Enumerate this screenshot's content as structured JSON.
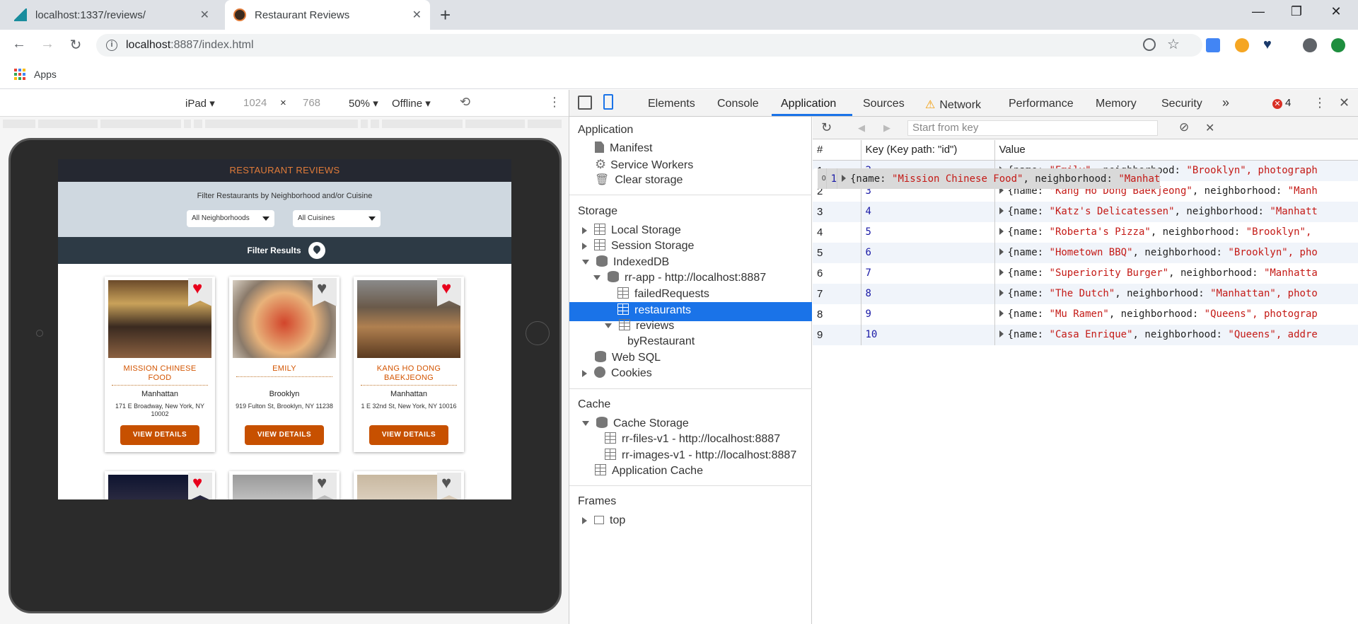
{
  "browser": {
    "tabs": [
      {
        "title": "localhost:1337/reviews/"
      },
      {
        "title": "Restaurant Reviews"
      }
    ],
    "url_host": "localhost",
    "url_rest": ":8887/index.html",
    "bookmarks_apps": "Apps"
  },
  "device_toolbar": {
    "device": "iPad",
    "width": "1024",
    "times": "×",
    "height": "768",
    "zoom": "50%",
    "throttle": "Offline"
  },
  "site": {
    "title": "RESTAURANT REVIEWS",
    "filter_title": "Filter Restaurants by Neighborhood and/or Cuisine",
    "neighborhood_select": "All Neighborhoods",
    "cuisine_select": "All Cuisines",
    "filter_results": "Filter Results",
    "view_details": "VIEW DETAILS",
    "cards": [
      {
        "name": "MISSION CHINESE FOOD",
        "neighborhood": "Manhattan",
        "address": "171 E Broadway, New York, NY 10002",
        "favorite": true
      },
      {
        "name": "EMILY",
        "neighborhood": "Brooklyn",
        "address": "919 Fulton St, Brooklyn, NY 11238",
        "favorite": false
      },
      {
        "name": "KANG HO DONG BAEKJEONG",
        "neighborhood": "Manhattan",
        "address": "1 E 32nd St, New York, NY 10016",
        "favorite": true
      }
    ],
    "second_row_favorites": [
      true,
      false,
      false
    ]
  },
  "devtools": {
    "tabs": [
      "Elements",
      "Console",
      "Application",
      "Sources",
      "Network",
      "Performance",
      "Memory",
      "Security"
    ],
    "active_tab": "Application",
    "more_tabs": "»",
    "error_count": "4",
    "sidebar": {
      "application_header": "Application",
      "manifest": "Manifest",
      "service_workers": "Service Workers",
      "clear_storage": "Clear storage",
      "storage_header": "Storage",
      "local_storage": "Local Storage",
      "session_storage": "Session Storage",
      "indexeddb": "IndexedDB",
      "db": "rr-app - http://localhost:8887",
      "failed_requests": "failedRequests",
      "restaurants": "restaurants",
      "reviews": "reviews",
      "by_restaurant": "byRestaurant",
      "web_sql": "Web SQL",
      "cookies": "Cookies",
      "cache_header": "Cache",
      "cache_storage": "Cache Storage",
      "cache_files": "rr-files-v1 - http://localhost:8887",
      "cache_images": "rr-images-v1 - http://localhost:8887",
      "application_cache": "Application Cache",
      "frames_header": "Frames",
      "frame_top": "top"
    },
    "start_from_key_placeholder": "Start from key",
    "table": {
      "headers": [
        "#",
        "Key (Key path: \"id\")",
        "Value"
      ],
      "rows": [
        {
          "idx": "0",
          "key": "1",
          "name": "\"Mission Chinese Food\"",
          "nbh": "\"Manhat"
        },
        {
          "idx": "1",
          "key": "2",
          "name": "\"Emily\"",
          "nbh": "\"Brooklyn\", photograph"
        },
        {
          "idx": "2",
          "key": "3",
          "name": "\"Kang Ho Dong Baekjeong\"",
          "nbh": "\"Manh"
        },
        {
          "idx": "3",
          "key": "4",
          "name": "\"Katz's Delicatessen\"",
          "nbh": "\"Manhatt"
        },
        {
          "idx": "4",
          "key": "5",
          "name": "\"Roberta's Pizza\"",
          "nbh": "\"Brooklyn\","
        },
        {
          "idx": "5",
          "key": "6",
          "name": "\"Hometown BBQ\"",
          "nbh": "\"Brooklyn\", pho"
        },
        {
          "idx": "6",
          "key": "7",
          "name": "\"Superiority Burger\"",
          "nbh": "\"Manhatta"
        },
        {
          "idx": "7",
          "key": "8",
          "name": "\"The Dutch\"",
          "nbh": "\"Manhattan\", photo"
        },
        {
          "idx": "8",
          "key": "9",
          "name": "\"Mu Ramen\"",
          "nbh": "\"Queens\", photograp"
        },
        {
          "idx": "9",
          "key": "10",
          "name": "\"Casa Enrique\"",
          "nbh": "\"Queens\", addre"
        }
      ]
    }
  },
  "colors": {
    "accent_blue": "#1a73e8",
    "site_header_bg": "#252831",
    "site_title_orange": "#e07b39",
    "details_button": "#c75000",
    "heart_red": "#e8001c",
    "heart_grey": "#555555"
  }
}
